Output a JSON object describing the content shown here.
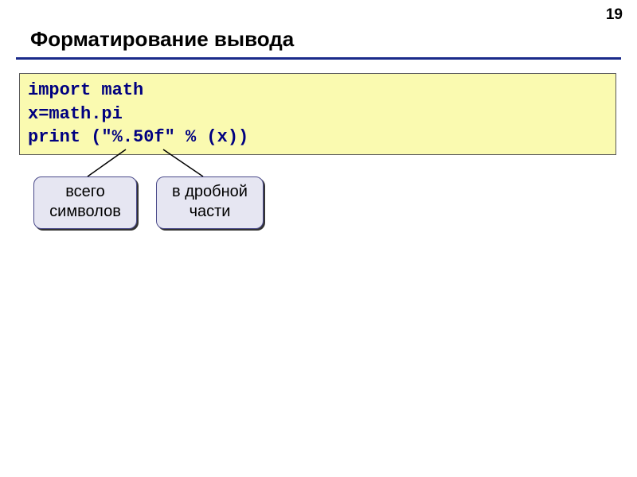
{
  "page_number": "19",
  "title": "Форматирование вывода",
  "code": {
    "line1": "import math",
    "line2": "x=math.pi",
    "line3": "print (\"%.50f\" % (x))"
  },
  "callouts": {
    "total_symbols": {
      "line1": "всего",
      "line2": "символов"
    },
    "fractional": {
      "line1": "в дробной",
      "line2": "части"
    }
  }
}
